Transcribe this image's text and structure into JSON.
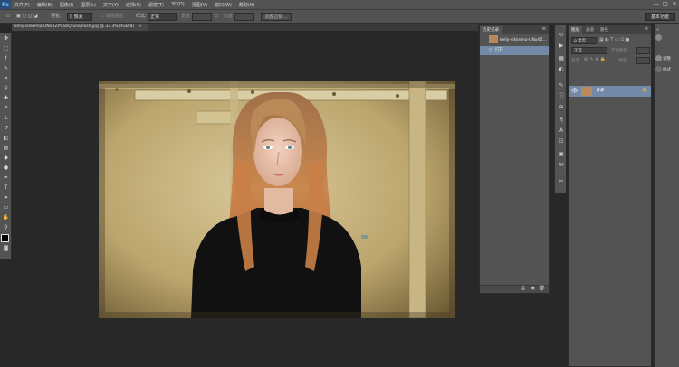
{
  "app": {
    "logo": "Ps",
    "menu": [
      "文件(F)",
      "编辑(E)",
      "图像(I)",
      "图层(L)",
      "文字(Y)",
      "选择(S)",
      "滤镜(T)",
      "3D(D)",
      "视图(V)",
      "窗口(W)",
      "帮助(H)"
    ],
    "window_controls": [
      "—",
      "□",
      "✕"
    ]
  },
  "options": {
    "feather_label": "羽化:",
    "feather_value": "0 像素",
    "antialias_label": "消除锯齿",
    "style_label": "样式:",
    "style_value": "正常",
    "width_label": "宽度:",
    "height_label": "高度:",
    "refine_edge": "调整边缘...",
    "workspace": "基本功能"
  },
  "document": {
    "tab_label": "kelly-sikkema-UNxXZPVSbQ-unsplash.jpg @ 33.3%(RGB/8)",
    "close": "×"
  },
  "history": {
    "tab_history": "历史记录",
    "tab_actions": "",
    "snapshot_label": "kelly-sikkema-UNxXZ...",
    "step_open": "打开"
  },
  "layers": {
    "tab_layers": "图层",
    "tab_channels": "通道",
    "tab_paths": "路径",
    "filter_kind": "ρ 类型",
    "blend_mode": "正常",
    "opacity_label": "不透明度:",
    "lock_label": "锁定:",
    "fill_label": "填充:",
    "layer_name": "背景"
  },
  "side_mini": {
    "adjust": "调整",
    "styles": "样式"
  },
  "colors": {
    "panel_bg": "#535353",
    "canvas_bg": "#282828",
    "selection": "#7389a8"
  }
}
